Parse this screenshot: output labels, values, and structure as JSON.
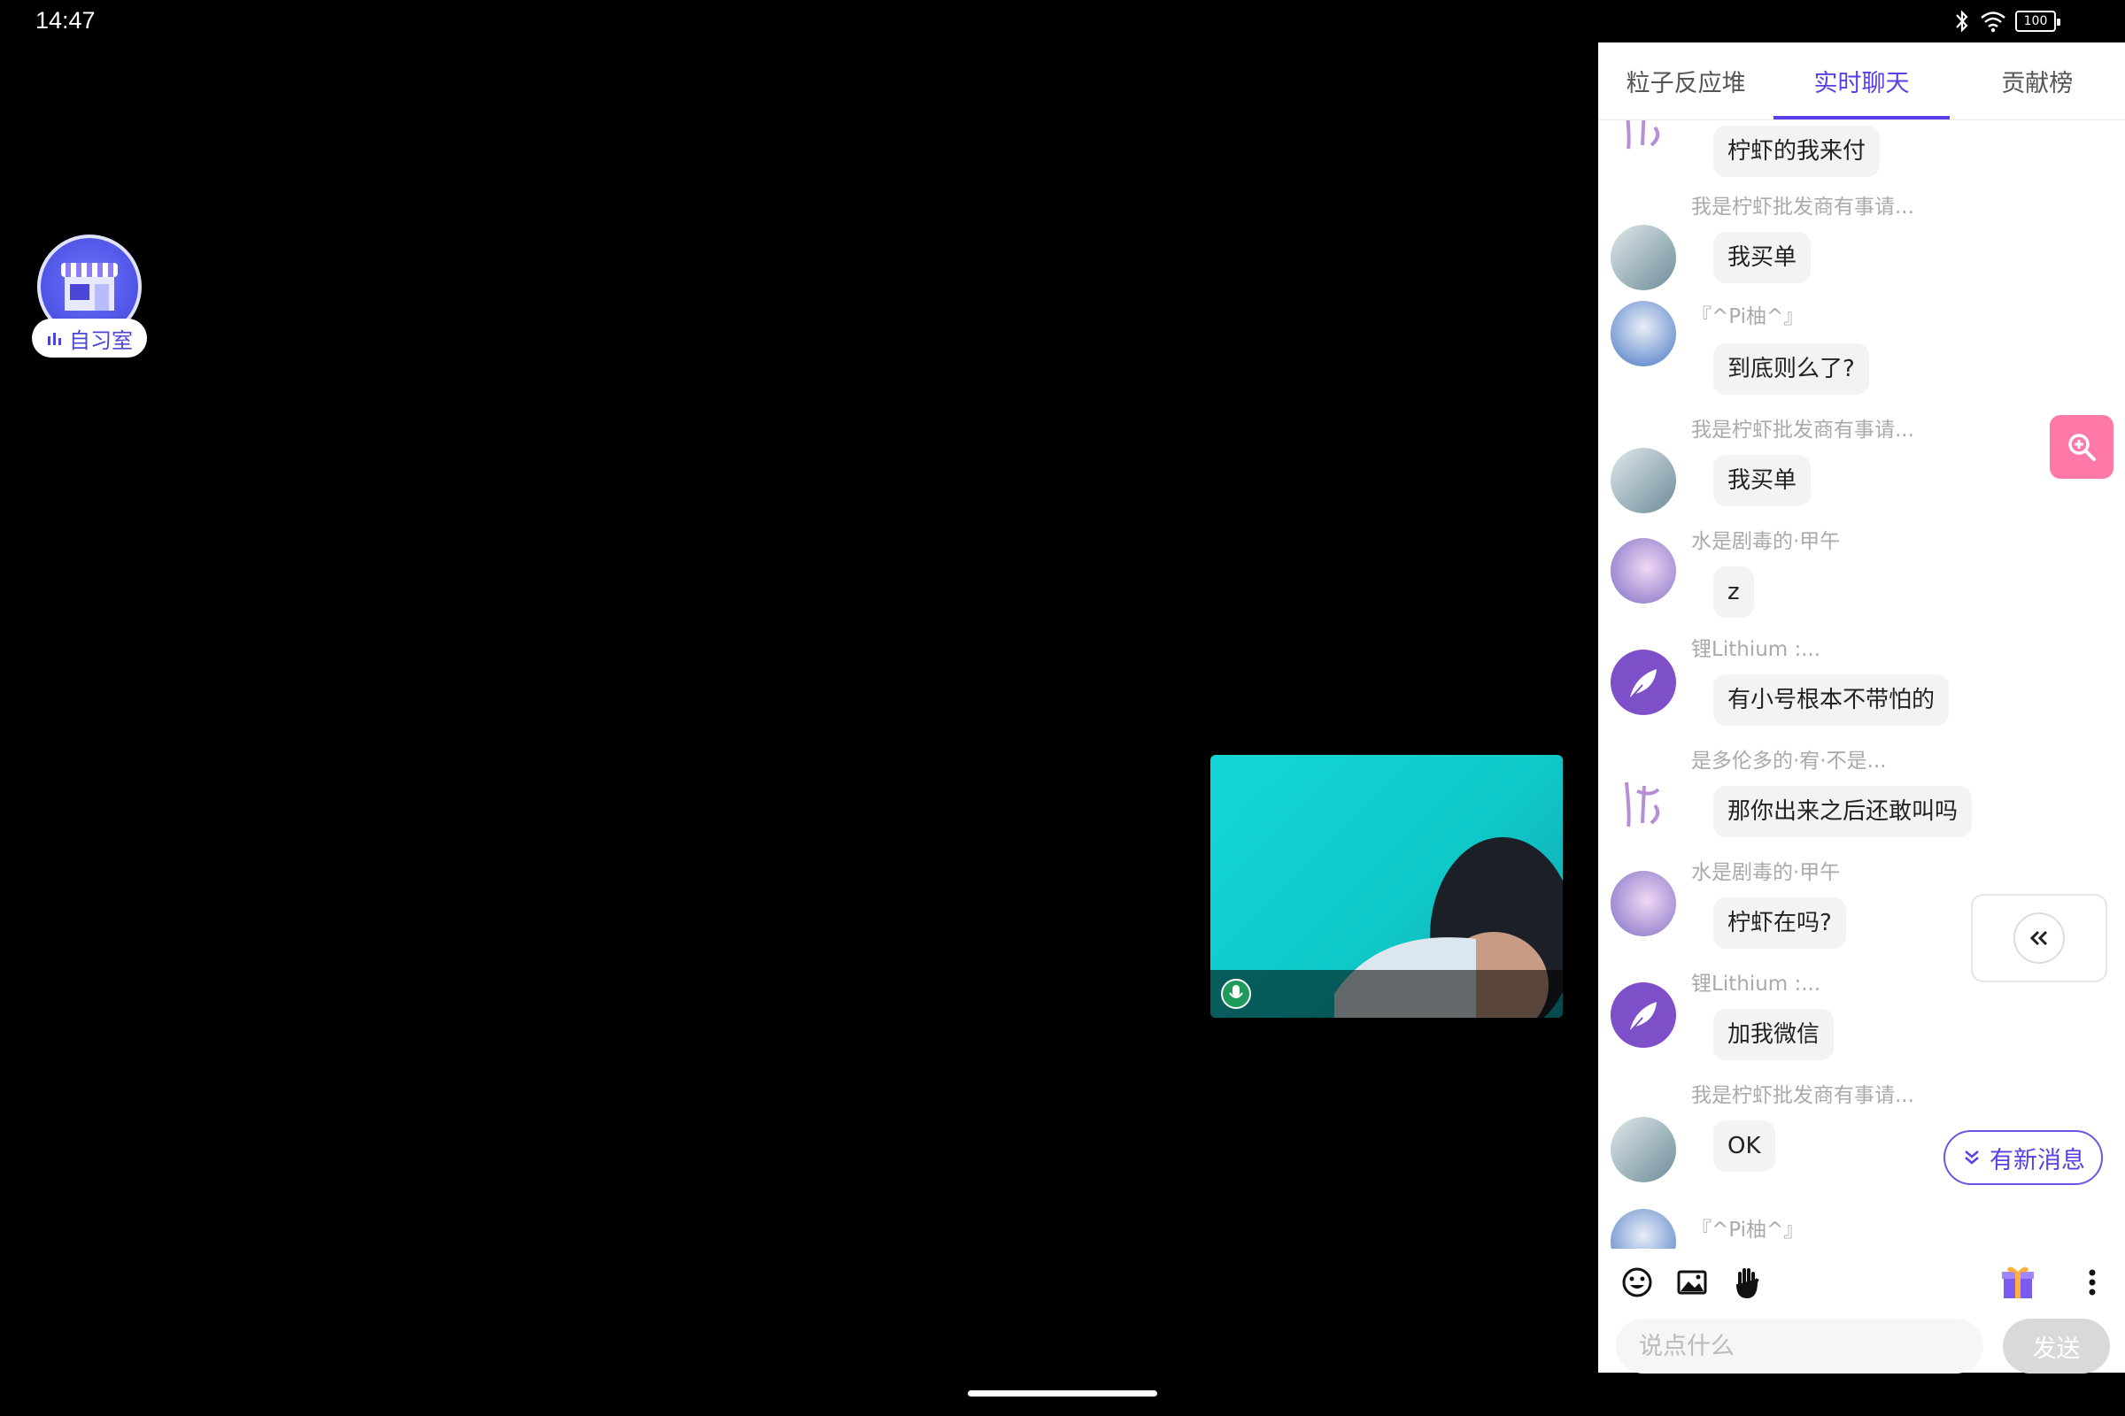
{
  "status_bar": {
    "time": "14:47",
    "battery": "100"
  },
  "floating": {
    "study_room_label": "自习室"
  },
  "tabs": [
    {
      "label": "粒子反应堆",
      "active": false
    },
    {
      "label": "实时聊天",
      "active": true
    },
    {
      "label": "贡献榜",
      "active": false
    }
  ],
  "messages": [
    {
      "user": "",
      "text": "柠虾的我来付",
      "avatar": "calligraphy"
    },
    {
      "user": "我是柠虾批发商有事请...",
      "text": "我买单",
      "avatar": "anime-green"
    },
    {
      "user": "『^Pi柚^』",
      "text": "到底则么了?",
      "avatar": "anime-white"
    },
    {
      "user": "我是柠虾批发商有事请...",
      "text": "我买单",
      "avatar": "anime-green"
    },
    {
      "user": "水是剧毒的·甲午",
      "text": "z",
      "avatar": "anime-purple"
    },
    {
      "user": "锂Lithium :...",
      "text": "有小号根本不带怕的",
      "avatar": "feather"
    },
    {
      "user": "是多伦多的·宥·不是...",
      "text": "那你出来之后还敢叫吗",
      "avatar": "calligraphy"
    },
    {
      "user": "水是剧毒的·甲午",
      "text": "柠虾在吗?",
      "avatar": "anime-purple"
    },
    {
      "user": "锂Lithium :...",
      "text": "加我微信",
      "avatar": "feather"
    },
    {
      "user": "我是柠虾批发商有事请...",
      "text": "OK",
      "avatar": "anime-green"
    },
    {
      "user": "『^Pi柚^』",
      "text": "",
      "avatar": "anime-white"
    }
  ],
  "input": {
    "placeholder": "说点什么",
    "send_label": "发送"
  },
  "new_messages_label": "有新消息",
  "colors": {
    "accent": "#5a3fe6",
    "zoom_button": "#ff79a8",
    "video_bg": "#15d6d6"
  }
}
